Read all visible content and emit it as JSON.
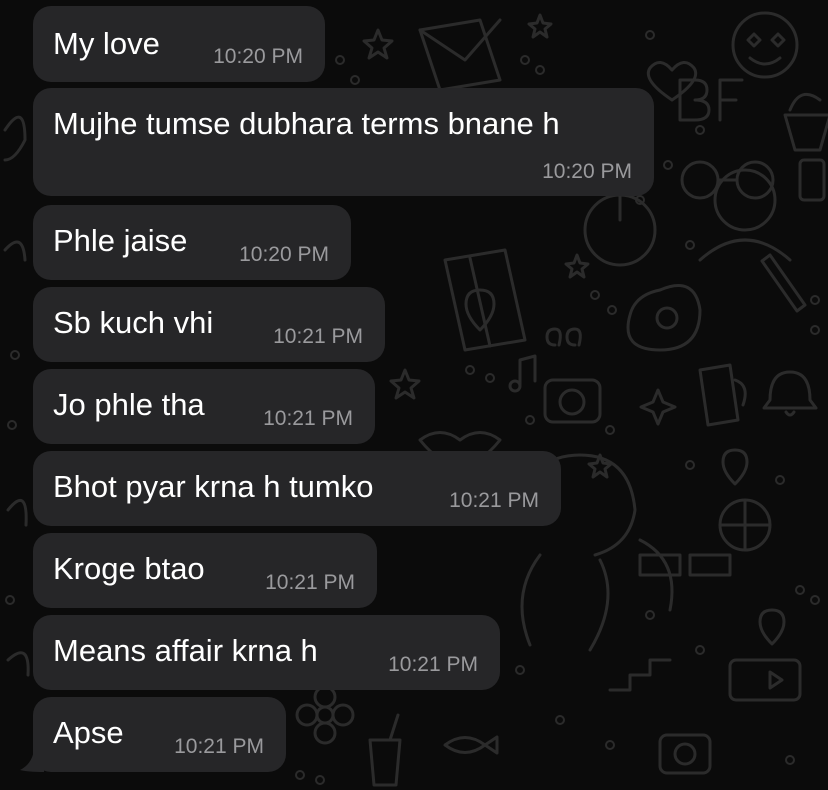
{
  "conversation": {
    "messages": [
      {
        "text": "My love",
        "time": "10:20 PM"
      },
      {
        "text": "Mujhe tumse dubhara terms bnane h",
        "time": "10:20 PM"
      },
      {
        "text": "Phle jaise",
        "time": "10:20 PM"
      },
      {
        "text": "Sb kuch vhi",
        "time": "10:21 PM"
      },
      {
        "text": "Jo phle tha",
        "time": "10:21 PM"
      },
      {
        "text": "Bhot pyar krna h tumko",
        "time": "10:21 PM"
      },
      {
        "text": "Kroge btao",
        "time": "10:21 PM"
      },
      {
        "text": "Means affair krna h",
        "time": "10:21 PM"
      },
      {
        "text": "Apse",
        "time": "10:21 PM"
      }
    ]
  },
  "theme": {
    "background": "#0b0b0b",
    "bubble_color": "#262628",
    "text_color": "#ffffff",
    "time_color": "#9a9a9d",
    "doodle_color": "#2a2a2a"
  }
}
